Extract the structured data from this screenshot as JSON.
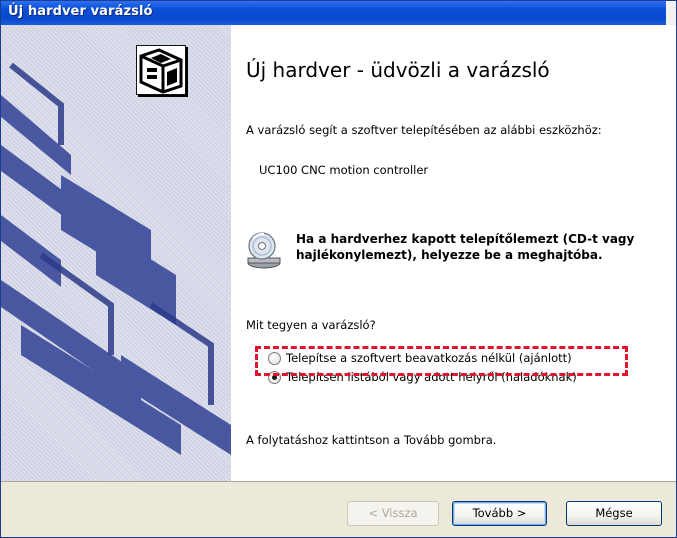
{
  "window": {
    "title": "Új hardver varázsló"
  },
  "content": {
    "heading": "Új hardver - üdvözli a varázsló",
    "intro": "A varázsló segít a szoftver telepítésében az alábbi eszközhöz:",
    "device": "UC100 CNC motion controller",
    "cd_message": "Ha a hardverhez kapott telepítőlemezt (CD-t vagy hajlékonylemezt), helyezze be a meghajtóba.",
    "question": "Mit tegyen a varázsló?",
    "options": [
      {
        "label": "Telepítse a szoftvert beavatkozás nélkül (ajánlott)",
        "selected": false
      },
      {
        "label": "Telepítsen listából vagy adott helyről (haladóknak)",
        "selected": true
      }
    ],
    "continue_hint": "A folytatáshoz kattintson a Tovább gombra."
  },
  "buttons": {
    "back": "< Vissza",
    "next": "Tovább >",
    "cancel": "Mégse"
  },
  "annotation": {
    "color": "#e0142a",
    "style": "dashed"
  },
  "icons": {
    "wizard_logo": "hardware-wizard-icon",
    "cd": "cd-drive-icon"
  },
  "colors": {
    "titlebar": "#0b48cc",
    "side_panel": "#d5d8e6",
    "footer": "#ece9d8"
  }
}
